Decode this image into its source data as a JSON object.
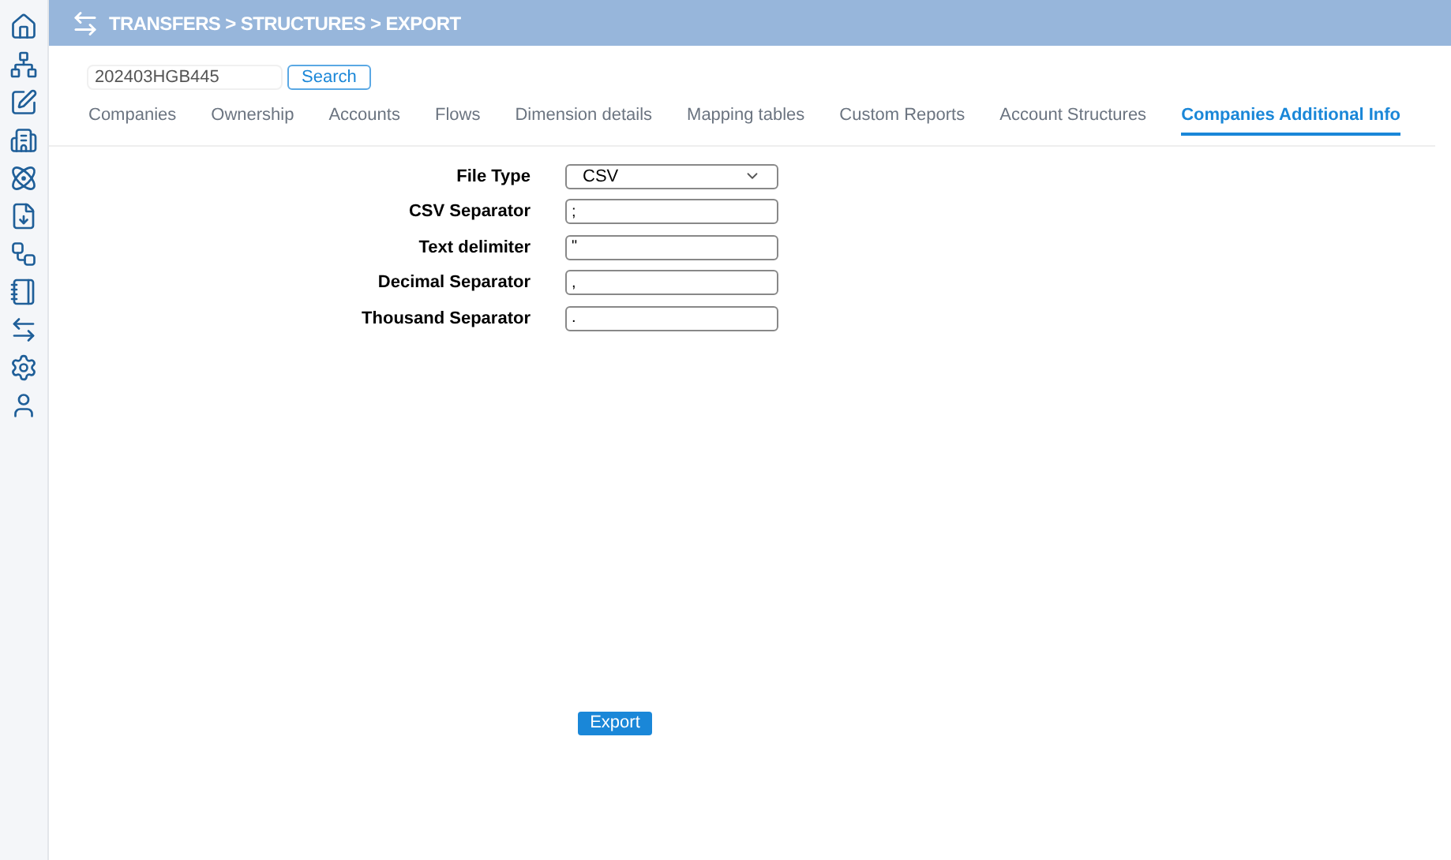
{
  "header": {
    "title": "TRANSFERS > STRUCTURES > EXPORT"
  },
  "search": {
    "value": "202403HGB445",
    "button": "Search"
  },
  "tabs": [
    {
      "label": "Companies",
      "selected": false
    },
    {
      "label": "Ownership",
      "selected": false
    },
    {
      "label": "Accounts",
      "selected": false
    },
    {
      "label": "Flows",
      "selected": false
    },
    {
      "label": "Dimension details",
      "selected": false
    },
    {
      "label": "Mapping tables",
      "selected": false
    },
    {
      "label": "Custom Reports",
      "selected": false
    },
    {
      "label": "Account Structures",
      "selected": false
    },
    {
      "label": "Companies Additional Info",
      "selected": true
    }
  ],
  "form": [
    {
      "label": "File Type",
      "kind": "select",
      "value": "CSV"
    },
    {
      "label": "CSV Separator",
      "kind": "text",
      "value": ";"
    },
    {
      "label": "Text delimiter",
      "kind": "text",
      "value": "\""
    },
    {
      "label": "Decimal Separator",
      "kind": "text",
      "value": ","
    },
    {
      "label": "Thousand Separator",
      "kind": "text",
      "value": "."
    }
  ],
  "export_button": "Export"
}
